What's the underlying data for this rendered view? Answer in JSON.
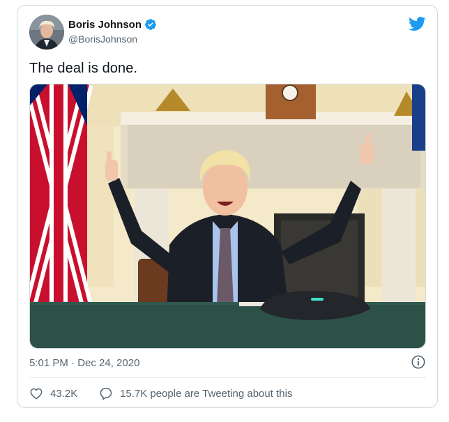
{
  "tweet": {
    "display_name": "Boris Johnson",
    "handle": "@BorisJohnson",
    "text": "The deal is done.",
    "timestamp": "5:01 PM · Dec 24, 2020",
    "likes": "43.2K",
    "tweeting_about": "15.7K people are Tweeting about this"
  },
  "icons": {
    "verified": "verified-badge-icon",
    "logo": "twitter-bird-icon",
    "info": "info-icon",
    "like": "heart-icon",
    "reply": "speech-bubble-icon"
  },
  "colors": {
    "brand": "#1d9bf0",
    "text_primary": "#0f1419",
    "text_secondary": "#536471",
    "border": "#cfd9de"
  }
}
